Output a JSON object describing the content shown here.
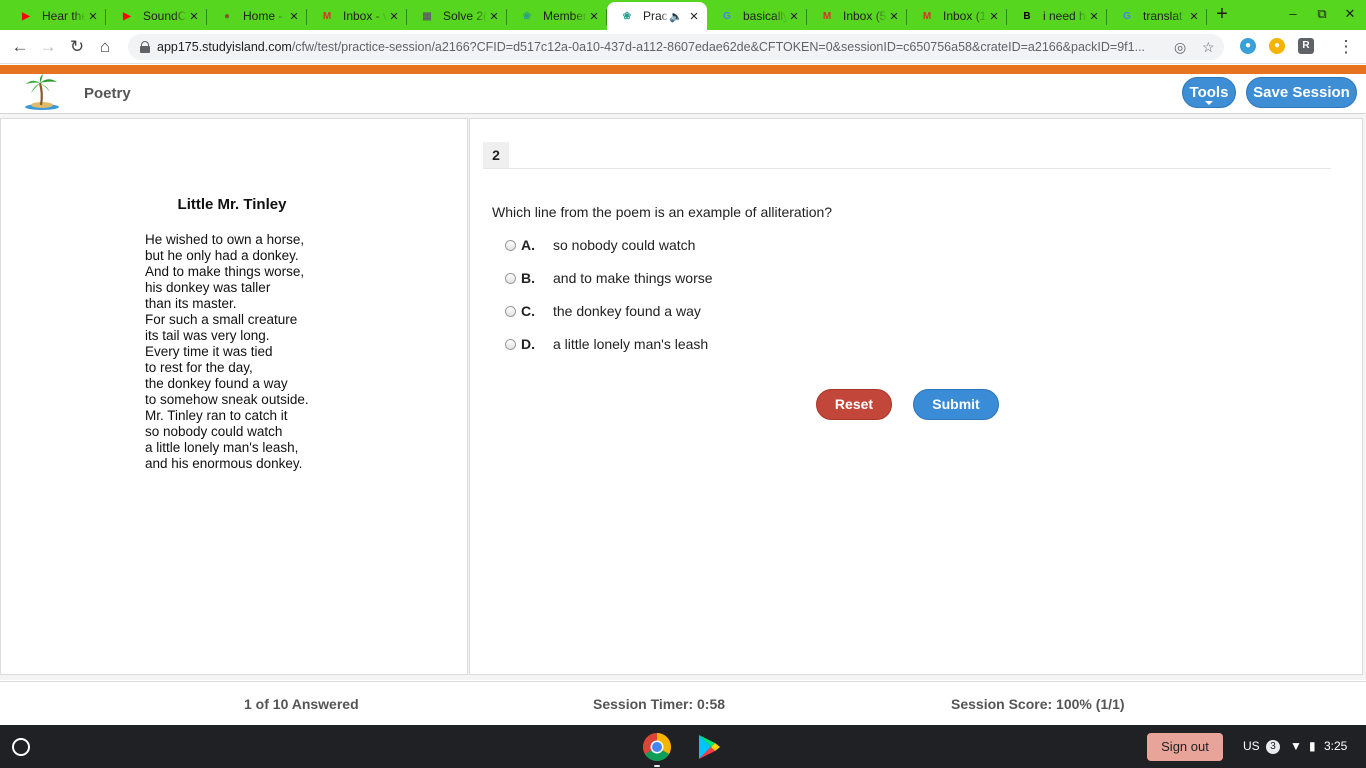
{
  "browser": {
    "tabs": [
      {
        "title": "Hear the",
        "icon": "youtube-icon",
        "icon_glyph": "▶",
        "icon_color": "#ff0000"
      },
      {
        "title": "SoundC",
        "icon": "youtube-icon",
        "icon_glyph": "▶",
        "icon_color": "#ff0000"
      },
      {
        "title": "Home - I",
        "icon": "app-icon",
        "icon_glyph": "●",
        "icon_color": "#7b5c2e"
      },
      {
        "title": "Inbox - v",
        "icon": "gmail-icon",
        "icon_glyph": "M",
        "icon_color": "#d93025"
      },
      {
        "title": "Solve 2(",
        "icon": "math-icon",
        "icon_glyph": "▦",
        "icon_color": "#5f6368"
      },
      {
        "title": "Member",
        "icon": "studyisland-icon",
        "icon_glyph": "❀",
        "icon_color": "#2a9d8f"
      },
      {
        "title": "Prac",
        "icon": "studyisland-icon",
        "icon_glyph": "❀",
        "icon_color": "#2a9d8f",
        "active": true
      },
      {
        "title": "basically",
        "icon": "google-icon",
        "icon_glyph": "G",
        "icon_color": "#4285f4"
      },
      {
        "title": "Inbox (5",
        "icon": "gmail-icon",
        "icon_glyph": "M",
        "icon_color": "#d93025"
      },
      {
        "title": "Inbox (1",
        "icon": "gmail-icon",
        "icon_glyph": "M",
        "icon_color": "#d93025"
      },
      {
        "title": "i need h",
        "icon": "brainly-icon",
        "icon_glyph": "B",
        "icon_color": "#000000"
      },
      {
        "title": "translat",
        "icon": "google-icon",
        "icon_glyph": "G",
        "icon_color": "#4285f4"
      }
    ],
    "url_host": "app175.studyisland.com",
    "url_path": "/cfw/test/practice-session/a2166?CFID=d517c12a-0a10-437d-a112-8607edae62de&CFTOKEN=0&sessionID=c650756a58&crateID=a2166&packID=9f1..."
  },
  "header": {
    "subject": "Poetry",
    "tools_label": "Tools",
    "save_label": "Save Session"
  },
  "passage": {
    "title": "Little Mr. Tinley",
    "lines": [
      "He wished to own a horse,",
      "but he only had a donkey.",
      "And to make things worse,",
      "his donkey was taller",
      "than its master.",
      "For such a small creature",
      "its tail was very long.",
      "Every time it was tied",
      "to rest for the day,",
      "the donkey found a way",
      "to somehow sneak outside.",
      "Mr. Tinley ran to catch it",
      "so nobody could watch",
      "a little lonely man's leash,",
      "and his enormous donkey."
    ]
  },
  "question": {
    "number": "2",
    "text": "Which line from the poem is an example of alliteration?",
    "options": [
      {
        "letter": "A.",
        "text": "so nobody could watch"
      },
      {
        "letter": "B.",
        "text": "and to make things worse"
      },
      {
        "letter": "C.",
        "text": "the donkey found a way"
      },
      {
        "letter": "D.",
        "text": "a little lonely man's leash"
      }
    ],
    "reset_label": "Reset",
    "submit_label": "Submit"
  },
  "footer": {
    "answered": "1 of 10 Answered",
    "timer": "Session Timer: 0:58",
    "score": "Session Score: 100% (1/1)"
  },
  "shelf": {
    "sign_out": "Sign out",
    "locale": "US",
    "notifications": "3",
    "time": "3:25"
  },
  "colors": {
    "tab_strip": "#56d61f",
    "brand_orange": "#e8731f",
    "button_blue": "#3d8ed4",
    "button_red": "#c2463a"
  }
}
